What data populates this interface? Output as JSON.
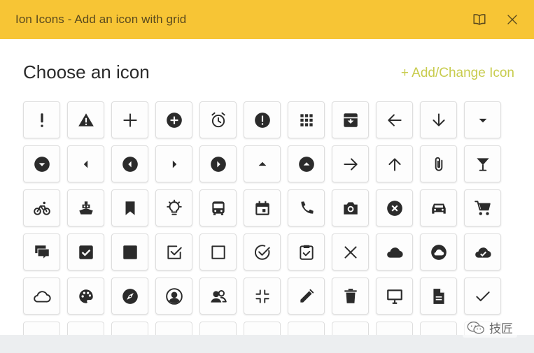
{
  "window": {
    "title": "Ion Icons - Add an icon with grid",
    "book_icon": "book-icon",
    "close_icon": "close-icon"
  },
  "main": {
    "heading": "Choose an icon",
    "add_link": "+ Add/Change Icon"
  },
  "colors": {
    "titlebar": "#f7c535",
    "accent_link": "#c8cc4e",
    "icon": "#2b2b2b"
  },
  "icon_grid": [
    "alert-icon",
    "warning-icon",
    "add-icon",
    "add-circle-icon",
    "alarm-icon",
    "alert-circle-icon",
    "apps-icon",
    "archive-icon",
    "arrow-back-icon",
    "arrow-down-icon",
    "arrow-dropdown-icon",
    "arrow-dropdown-circle-icon",
    "arrow-dropleft-icon",
    "arrow-dropleft-circle-icon",
    "arrow-dropright-icon",
    "arrow-dropright-circle-icon",
    "arrow-dropup-icon",
    "arrow-dropup-circle-icon",
    "arrow-forward-icon",
    "arrow-up-icon",
    "attach-icon",
    "cocktail-icon",
    "bicycle-icon",
    "boat-icon",
    "bookmark-icon",
    "bulb-icon",
    "bus-icon",
    "calendar-icon",
    "call-icon",
    "camera-icon",
    "close-circle-icon",
    "car-icon",
    "cart-icon",
    "chatboxes-icon",
    "checkbox-icon",
    "square-filled-icon",
    "checkbox-outline-icon",
    "square-outline-icon",
    "checkmark-circle-outline-icon",
    "clipboard-icon",
    "close-icon",
    "cloud-icon",
    "cloud-circle-icon",
    "cloud-done-icon",
    "cloud-outline-icon",
    "color-palette-icon",
    "compass-icon",
    "contact-icon",
    "contacts-icon",
    "contract-icon",
    "create-icon",
    "trash-icon",
    "desktop-icon",
    "document-icon",
    "checkmark-icon"
  ],
  "watermark": {
    "text": "技匠",
    "icon": "wechat-icon"
  }
}
